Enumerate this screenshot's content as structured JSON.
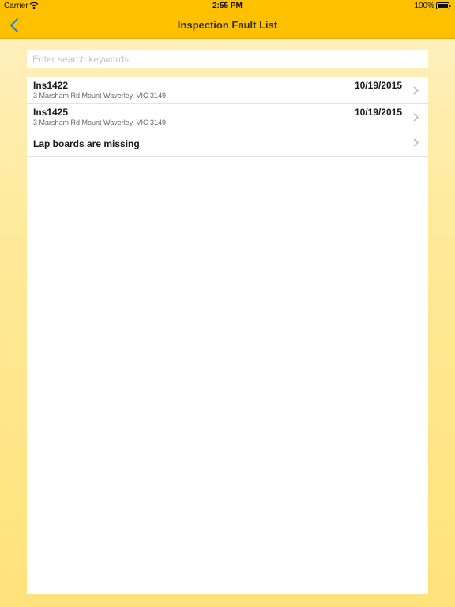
{
  "status_bar": {
    "carrier": "Carrier",
    "time": "2:55 PM",
    "battery": "100%"
  },
  "nav": {
    "title": "Inspection Fault List",
    "back_icon": "chevron-left-icon"
  },
  "search": {
    "placeholder": "Enter search keywords",
    "value": ""
  },
  "list": {
    "items": [
      {
        "title": "Ins1422",
        "address": "3 Marsham Rd Mount Waverley, VIC 3149",
        "date": "10/19/2015"
      },
      {
        "title": "Ins1425",
        "address": "3 Marsham Rd Mount Waverley, VIC 3149",
        "date": "10/19/2015"
      },
      {
        "title": "Lap boards are missing"
      }
    ]
  },
  "colors": {
    "nav_background": "#ffc000",
    "back_icon": "#1e88e5",
    "page_background_top": "#fff1c2",
    "page_background_bottom": "#ffe27a"
  }
}
